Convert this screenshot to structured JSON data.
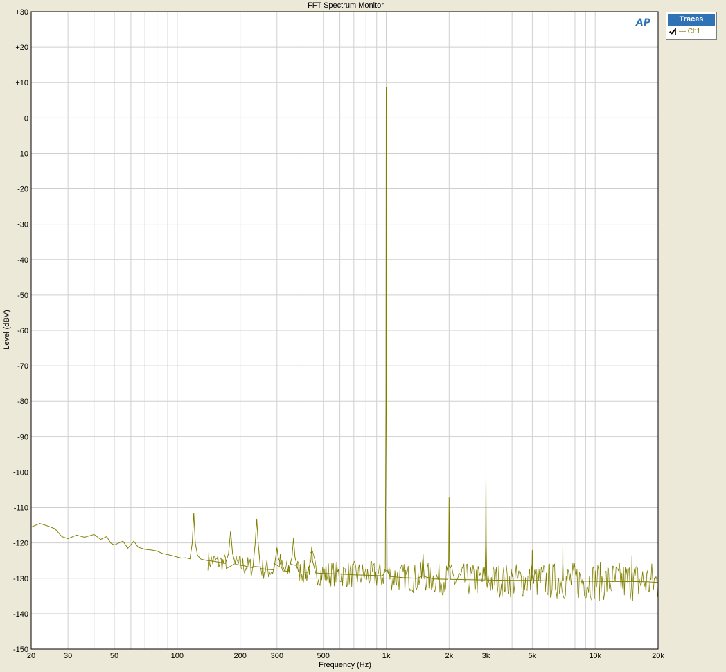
{
  "window": {
    "title": "FFT Spectrum Monitor"
  },
  "legend": {
    "header": "Traces",
    "items": [
      {
        "label": "Ch1",
        "checked": true,
        "color": "#808000"
      }
    ]
  },
  "logo": {
    "text": "AP"
  },
  "chart_data": {
    "type": "line",
    "title": "FFT Spectrum Monitor",
    "xlabel": "Frequency (Hz)",
    "ylabel": "Level (dBV)",
    "xscale": "log",
    "xlim": [
      20,
      20000
    ],
    "ylim": [
      -150,
      30
    ],
    "grid": true,
    "legend_position": "outside-top-right",
    "xticks": [
      {
        "value": 20,
        "label": "20"
      },
      {
        "value": 30,
        "label": "30"
      },
      {
        "value": 50,
        "label": "50"
      },
      {
        "value": 100,
        "label": "100"
      },
      {
        "value": 200,
        "label": "200"
      },
      {
        "value": 300,
        "label": "300"
      },
      {
        "value": 500,
        "label": "500"
      },
      {
        "value": 1000,
        "label": "1k"
      },
      {
        "value": 2000,
        "label": "2k"
      },
      {
        "value": 3000,
        "label": "3k"
      },
      {
        "value": 5000,
        "label": "5k"
      },
      {
        "value": 10000,
        "label": "10k"
      },
      {
        "value": 20000,
        "label": "20k"
      }
    ],
    "yticks": [
      {
        "value": 30,
        "label": "+30"
      },
      {
        "value": 20,
        "label": "+20"
      },
      {
        "value": 10,
        "label": "+10"
      },
      {
        "value": 0,
        "label": "0"
      },
      {
        "value": -10,
        "label": "-10"
      },
      {
        "value": -20,
        "label": "-20"
      },
      {
        "value": -30,
        "label": "-30"
      },
      {
        "value": -40,
        "label": "-40"
      },
      {
        "value": -50,
        "label": "-50"
      },
      {
        "value": -60,
        "label": "-60"
      },
      {
        "value": -70,
        "label": "-70"
      },
      {
        "value": -80,
        "label": "-80"
      },
      {
        "value": -90,
        "label": "-90"
      },
      {
        "value": -100,
        "label": "-100"
      },
      {
        "value": -110,
        "label": "-110"
      },
      {
        "value": -120,
        "label": "-120"
      },
      {
        "value": -130,
        "label": "-130"
      },
      {
        "value": -140,
        "label": "-140"
      },
      {
        "value": -150,
        "label": "-150"
      }
    ],
    "series": [
      {
        "name": "Ch1",
        "color": "#808000",
        "points": [
          [
            20,
            -115.5
          ],
          [
            22,
            -114.5
          ],
          [
            24,
            -115.2
          ],
          [
            26,
            -116.0
          ],
          [
            28,
            -118.2
          ],
          [
            30,
            -118.8
          ],
          [
            33,
            -117.8
          ],
          [
            36,
            -118.4
          ],
          [
            40,
            -117.6
          ],
          [
            43,
            -119.0
          ],
          [
            46,
            -118.2
          ],
          [
            48,
            -120.0
          ],
          [
            50,
            -120.6
          ],
          [
            55,
            -119.5
          ],
          [
            58,
            -121.5
          ],
          [
            62,
            -119.5
          ],
          [
            65,
            -121.2
          ],
          [
            70,
            -121.8
          ],
          [
            75,
            -122.0
          ],
          [
            80,
            -122.3
          ],
          [
            85,
            -123.0
          ],
          [
            90,
            -123.3
          ],
          [
            95,
            -123.6
          ],
          [
            100,
            -124.0
          ],
          [
            105,
            -124.3
          ],
          [
            110,
            -124.2
          ],
          [
            115,
            -124.5
          ],
          [
            118,
            -120.0
          ],
          [
            120,
            -111.5
          ],
          [
            122,
            -120.0
          ],
          [
            125,
            -123.5
          ],
          [
            130,
            -124.6
          ],
          [
            140,
            -125.0
          ],
          [
            150,
            -125.2
          ],
          [
            160,
            -125.5
          ],
          [
            170,
            -125.8
          ],
          [
            176,
            -123.0
          ],
          [
            180,
            -116.6
          ],
          [
            184,
            -123.0
          ],
          [
            190,
            -126.0
          ],
          [
            200,
            -126.3
          ],
          [
            210,
            -126.5
          ],
          [
            220,
            -126.8
          ],
          [
            230,
            -127.0
          ],
          [
            236,
            -120.0
          ],
          [
            240,
            -113.2
          ],
          [
            244,
            -120.0
          ],
          [
            250,
            -127.2
          ],
          [
            270,
            -127.5
          ],
          [
            290,
            -127.6
          ],
          [
            296,
            -124.0
          ],
          [
            300,
            -121.3
          ],
          [
            304,
            -124.0
          ],
          [
            320,
            -127.9
          ],
          [
            340,
            -128.0
          ],
          [
            354,
            -124.0
          ],
          [
            360,
            -118.7
          ],
          [
            366,
            -124.0
          ],
          [
            380,
            -128.1
          ],
          [
            420,
            -128.3
          ],
          [
            436,
            -125.0
          ],
          [
            440,
            -121.0
          ],
          [
            444,
            -125.0
          ],
          [
            460,
            -128.5
          ],
          [
            500,
            -128.6
          ],
          [
            600,
            -128.8
          ],
          [
            700,
            -129.0
          ],
          [
            800,
            -129.1
          ],
          [
            900,
            -129.2
          ],
          [
            960,
            -129.3
          ],
          [
            990,
            -128.0
          ],
          [
            997,
            -80.0
          ],
          [
            1000,
            8.8
          ],
          [
            1003,
            -80.0
          ],
          [
            1010,
            -128.0
          ],
          [
            1050,
            -129.5
          ],
          [
            1200,
            -129.8
          ],
          [
            1400,
            -130.0
          ],
          [
            1480,
            -129.5
          ],
          [
            1500,
            -124.8
          ],
          [
            1520,
            -129.5
          ],
          [
            1700,
            -130.2
          ],
          [
            1970,
            -130.3
          ],
          [
            1990,
            -125.0
          ],
          [
            2000,
            -107.2
          ],
          [
            2010,
            -125.0
          ],
          [
            2030,
            -130.3
          ],
          [
            2500,
            -130.4
          ],
          [
            2970,
            -130.5
          ],
          [
            2990,
            -120.0
          ],
          [
            3000,
            -101.5
          ],
          [
            3010,
            -120.0
          ],
          [
            3030,
            -130.5
          ],
          [
            4000,
            -130.6
          ],
          [
            4960,
            -130.6
          ],
          [
            4990,
            -126.0
          ],
          [
            5000,
            -122.0
          ],
          [
            5010,
            -126.0
          ],
          [
            5040,
            -130.6
          ],
          [
            6000,
            -130.7
          ],
          [
            6960,
            -130.7
          ],
          [
            6990,
            -126.0
          ],
          [
            7000,
            -120.3
          ],
          [
            7010,
            -126.0
          ],
          [
            7040,
            -130.7
          ],
          [
            9000,
            -130.8
          ],
          [
            12000,
            -130.9
          ],
          [
            14900,
            -130.9
          ],
          [
            14970,
            -128.0
          ],
          [
            15000,
            -123.5
          ],
          [
            15030,
            -128.0
          ],
          [
            15100,
            -130.9
          ],
          [
            18000,
            -131.0
          ],
          [
            20000,
            -131.2
          ]
        ]
      }
    ]
  }
}
